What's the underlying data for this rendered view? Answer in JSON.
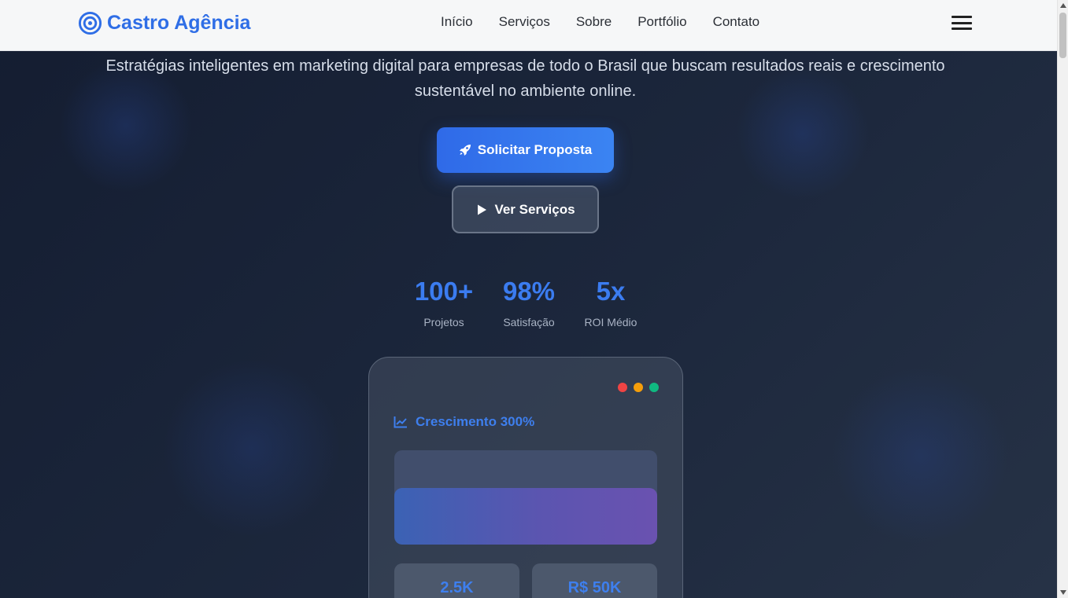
{
  "header": {
    "brand": "Castro Agência",
    "nav": [
      "Início",
      "Serviços",
      "Sobre",
      "Portfólio",
      "Contato"
    ],
    "menu_icon": "hamburger-menu-icon",
    "brand_color": "#2f6ee6"
  },
  "hero": {
    "subtitle": "Estratégias inteligentes em marketing digital para empresas de todo o Brasil que buscam resultados reais e crescimento sustentável no ambiente online.",
    "primary_button": {
      "label": "Solicitar Proposta",
      "icon": "rocket-icon"
    },
    "secondary_button": {
      "label": "Ver Serviços",
      "icon": "play-icon"
    }
  },
  "stats": [
    {
      "value": "100+",
      "label": "Projetos"
    },
    {
      "value": "98%",
      "label": "Satisfação"
    },
    {
      "value": "5x",
      "label": "ROI Médio"
    }
  ],
  "card": {
    "window_dots": [
      "#ef4444",
      "#f59e0b",
      "#10b981"
    ],
    "title": "Crescimento 300%",
    "title_icon": "chart-line-icon",
    "growth_fill": 0.6,
    "metrics": [
      "2.5K",
      "R$ 50K"
    ]
  },
  "colors": {
    "accent": "#3b7cf0",
    "background": "#1b2538"
  }
}
